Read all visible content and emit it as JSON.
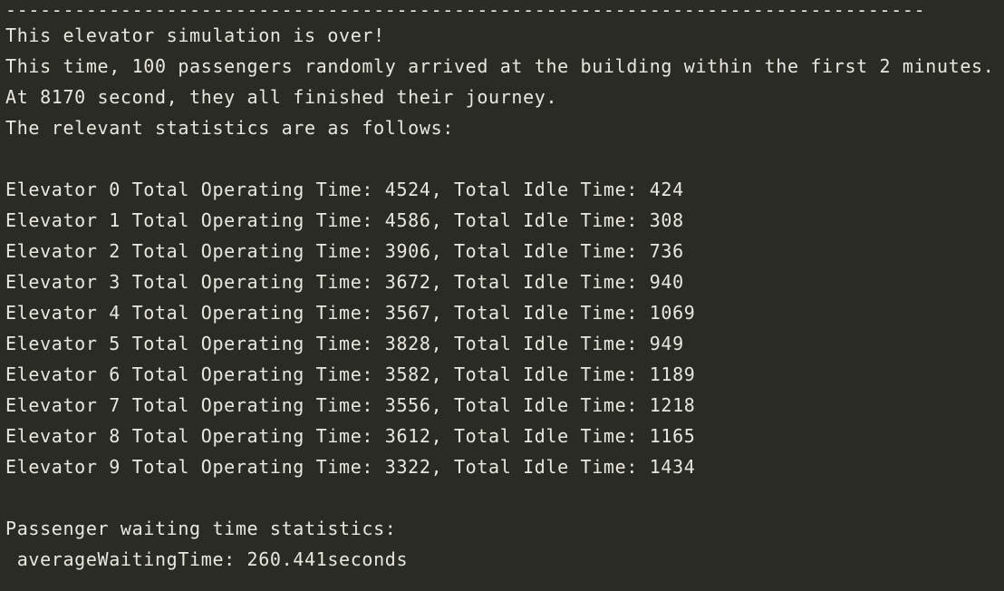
{
  "console": {
    "separator": "--------------------------------------------------------------------------------",
    "lines": [
      "This elevator simulation is over!",
      "This time, 100 passengers randomly arrived at the building within the first 2 minutes.",
      "At 8170 second, they all finished their journey.",
      "The relevant statistics are as follows:",
      "",
      "Elevator 0 Total Operating Time: 4524, Total Idle Time: 424",
      "Elevator 1 Total Operating Time: 4586, Total Idle Time: 308",
      "Elevator 2 Total Operating Time: 3906, Total Idle Time: 736",
      "Elevator 3 Total Operating Time: 3672, Total Idle Time: 940",
      "Elevator 4 Total Operating Time: 3567, Total Idle Time: 1069",
      "Elevator 5 Total Operating Time: 3828, Total Idle Time: 949",
      "Elevator 6 Total Operating Time: 3582, Total Idle Time: 1189",
      "Elevator 7 Total Operating Time: 3556, Total Idle Time: 1218",
      "Elevator 8 Total Operating Time: 3612, Total Idle Time: 1165",
      "Elevator 9 Total Operating Time: 3322, Total Idle Time: 1434",
      "",
      "Passenger waiting time statistics:",
      " averageWaitingTime: 260.441seconds"
    ]
  },
  "colors": {
    "background": "#2b2b26",
    "text": "#e8e8e0"
  }
}
